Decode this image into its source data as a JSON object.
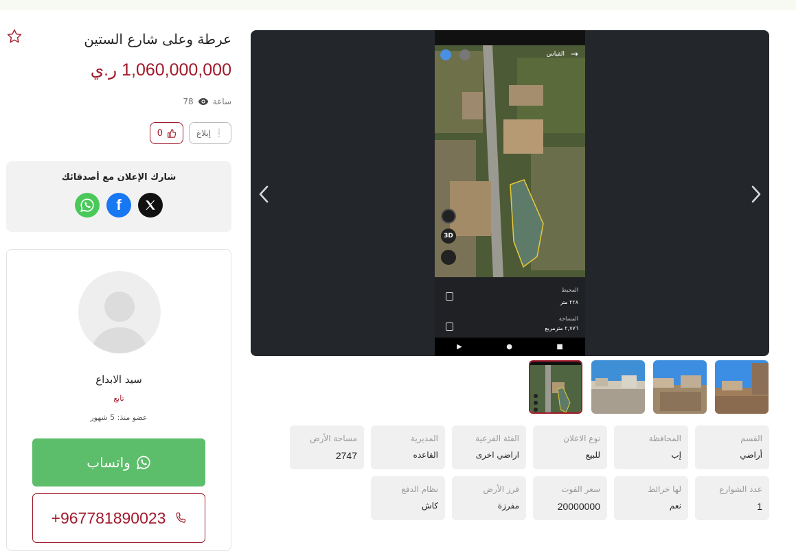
{
  "listing": {
    "title": "عرطة وعلى شارع الستين",
    "price": "1,060,000,000 ر.ي",
    "time_label": "ساعة",
    "views": "78",
    "report_label": "إبلاغ",
    "likes": "0"
  },
  "share": {
    "title": "شارك الإعلان مع أصدقائك",
    "icons": [
      "x-icon",
      "facebook-icon",
      "whatsapp-icon"
    ]
  },
  "seller": {
    "name": "سيد الابداع",
    "follow_label": "تابع",
    "member_since": "عضو منذ: 5 شهور",
    "whatsapp_label": "واتساب",
    "phone": "+967781890023"
  },
  "gallery": {
    "screenshot": {
      "top_label": "القياس",
      "perimeter_label": "المحيط",
      "perimeter_value": "٢٢٨ متر",
      "area_label": "المساحة",
      "area_value": "٢,٧٧٦ مترمربع",
      "badge_3d": "3D"
    },
    "thumbnail_count": 4,
    "active_thumbnail": 0
  },
  "specs": [
    {
      "key": "القسم",
      "value": "أراضي"
    },
    {
      "key": "المحافظة",
      "value": "إب"
    },
    {
      "key": "نوع الاعلان",
      "value": "للبيع"
    },
    {
      "key": "الفئة الفرعية",
      "value": "اراضي اخرى"
    },
    {
      "key": "المديرية",
      "value": "القاعده"
    },
    {
      "key": "مساحة الأرض",
      "value": "2747"
    },
    {
      "key": "عدد الشوارع",
      "value": "1"
    },
    {
      "key": "لها خرائط",
      "value": "نعم"
    },
    {
      "key": "سعر الفوت",
      "value": "20000000"
    },
    {
      "key": "فرز الأرض",
      "value": "مفرزة"
    },
    {
      "key": "نظام الدفع",
      "value": "كاش"
    }
  ],
  "colors": {
    "accent": "#a11a2b",
    "whatsapp": "#5cbd6b",
    "gallery_bg": "#23262b",
    "spec_bg": "#f0f0f0"
  }
}
